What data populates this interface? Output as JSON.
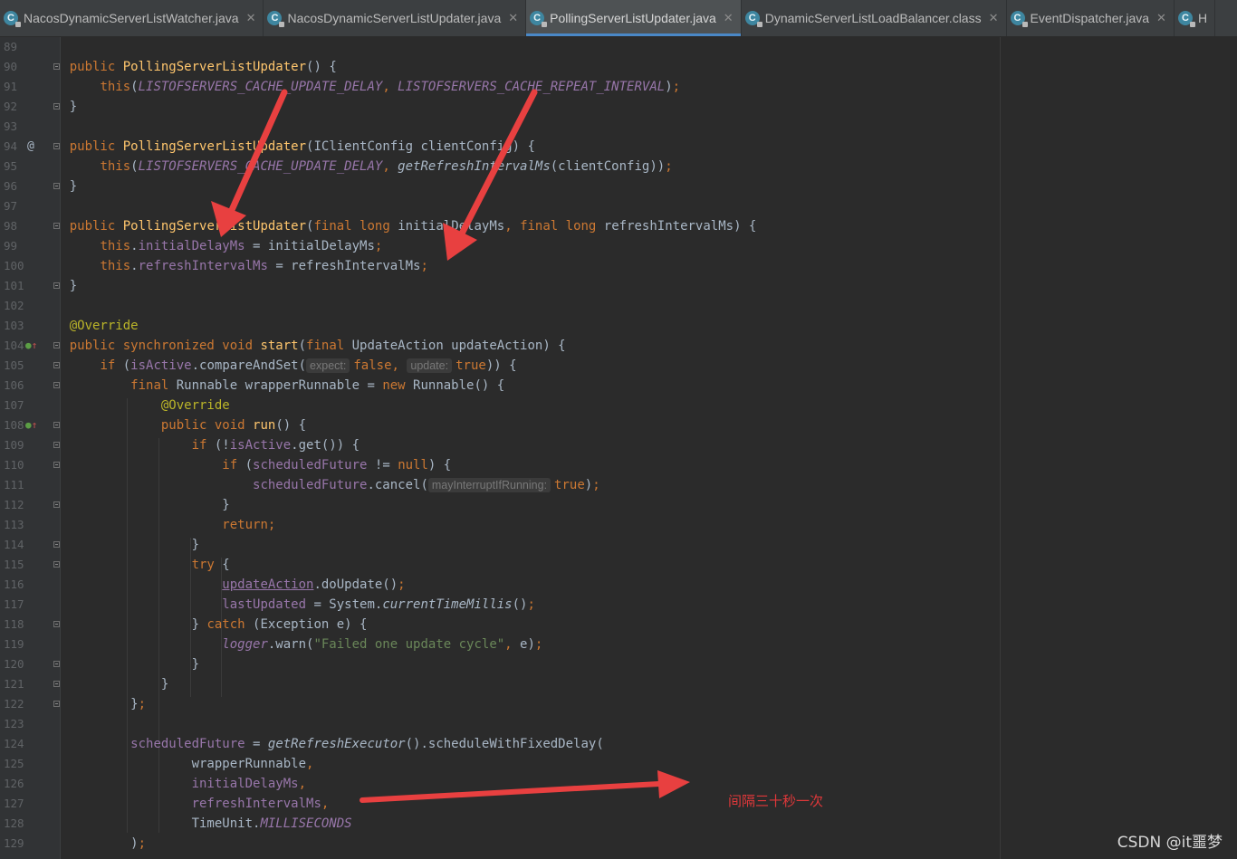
{
  "tabs": [
    {
      "label": "NacosDynamicServerListWatcher.java",
      "icon": "java-class-icon",
      "active": false
    },
    {
      "label": "NacosDynamicServerListUpdater.java",
      "icon": "java-class-icon",
      "active": false
    },
    {
      "label": "PollingServerListUpdater.java",
      "icon": "java-class-icon",
      "active": true
    },
    {
      "label": "DynamicServerListLoadBalancer.class",
      "icon": "java-class-icon",
      "active": false
    },
    {
      "label": "EventDispatcher.java",
      "icon": "java-class-icon",
      "active": false
    },
    {
      "label": "H",
      "icon": "java-class-icon",
      "active": false
    }
  ],
  "tab_close_glyph": "✕",
  "tab_icon_letter": "C",
  "gutter": {
    "line_numbers": [
      "89",
      "90",
      "91",
      "92",
      "93",
      "94",
      "95",
      "96",
      "97",
      "98",
      "99",
      "100",
      "101",
      "102",
      "103",
      "104",
      "105",
      "106",
      "107",
      "108",
      "109",
      "110",
      "111",
      "112",
      "113",
      "114",
      "115",
      "116",
      "117",
      "118",
      "119",
      "120",
      "121",
      "122",
      "123",
      "124",
      "125",
      "126",
      "127",
      "128",
      "129"
    ],
    "markers": {
      "94": "@",
      "104": "implements-icon",
      "108": "implements-icon"
    }
  },
  "code_lines": [
    [],
    [
      {
        "t": "    "
      },
      {
        "t": "public ",
        "c": "kw"
      },
      {
        "t": "PollingServerListUpdater",
        "c": "fn"
      },
      {
        "t": "() {"
      }
    ],
    [
      {
        "t": "        "
      },
      {
        "t": "this",
        "c": "kw"
      },
      {
        "t": "("
      },
      {
        "t": "LISTOFSERVERS_CACHE_UPDATE_DELAY",
        "c": "sfld"
      },
      {
        "t": ", ",
        "c": "kw"
      },
      {
        "t": "LISTOFSERVERS_CACHE_REPEAT_INTERVAL",
        "c": "sfld"
      },
      {
        "t": ")"
      },
      {
        "t": ";",
        "c": "kw"
      }
    ],
    [
      {
        "t": "    }"
      }
    ],
    [],
    [
      {
        "t": "    "
      },
      {
        "t": "public ",
        "c": "kw"
      },
      {
        "t": "PollingServerListUpdater",
        "c": "fn"
      },
      {
        "t": "(IClientConfig clientConfig) {"
      }
    ],
    [
      {
        "t": "        "
      },
      {
        "t": "this",
        "c": "kw"
      },
      {
        "t": "("
      },
      {
        "t": "LISTOFSERVERS_CACHE_UPDATE_DELAY",
        "c": "sfld"
      },
      {
        "t": ", ",
        "c": "kw"
      },
      {
        "t": "getRefreshIntervalMs",
        "c": "sm"
      },
      {
        "t": "(clientConfig))"
      },
      {
        "t": ";",
        "c": "kw"
      }
    ],
    [
      {
        "t": "    }"
      }
    ],
    [],
    [
      {
        "t": "    "
      },
      {
        "t": "public ",
        "c": "kw"
      },
      {
        "t": "PollingServerListUpdater",
        "c": "fn"
      },
      {
        "t": "("
      },
      {
        "t": "final long ",
        "c": "kw"
      },
      {
        "t": "initialDelayMs"
      },
      {
        "t": ", ",
        "c": "kw"
      },
      {
        "t": "final long ",
        "c": "kw"
      },
      {
        "t": "refreshIntervalMs) {"
      }
    ],
    [
      {
        "t": "        "
      },
      {
        "t": "this",
        "c": "kw"
      },
      {
        "t": "."
      },
      {
        "t": "initialDelayMs",
        "c": "fld"
      },
      {
        "t": " = initialDelayMs"
      },
      {
        "t": ";",
        "c": "kw"
      }
    ],
    [
      {
        "t": "        "
      },
      {
        "t": "this",
        "c": "kw"
      },
      {
        "t": "."
      },
      {
        "t": "refreshIntervalMs",
        "c": "fld"
      },
      {
        "t": " = refreshIntervalMs"
      },
      {
        "t": ";",
        "c": "kw"
      }
    ],
    [
      {
        "t": "    }"
      }
    ],
    [],
    [
      {
        "t": "    "
      },
      {
        "t": "@Override",
        "c": "ann"
      }
    ],
    [
      {
        "t": "    "
      },
      {
        "t": "public synchronized void ",
        "c": "kw"
      },
      {
        "t": "start",
        "c": "fn"
      },
      {
        "t": "("
      },
      {
        "t": "final ",
        "c": "kw"
      },
      {
        "t": "UpdateAction updateAction) {"
      }
    ],
    [
      {
        "t": "        "
      },
      {
        "t": "if ",
        "c": "kw"
      },
      {
        "t": "("
      },
      {
        "t": "isActive",
        "c": "fld"
      },
      {
        "t": ".compareAndSet("
      },
      {
        "t": "expect:",
        "c": "hint"
      },
      {
        "t": "false",
        "c": "kw"
      },
      {
        "t": ", ",
        "c": "kw"
      },
      {
        "t": "update:",
        "c": "hint"
      },
      {
        "t": "true",
        "c": "kw"
      },
      {
        "t": ")) {"
      }
    ],
    [
      {
        "t": "            "
      },
      {
        "t": "final ",
        "c": "kw"
      },
      {
        "t": "Runnable wrapperRunnable = "
      },
      {
        "t": "new ",
        "c": "kw"
      },
      {
        "t": "Runnable() {"
      }
    ],
    [
      {
        "t": "                "
      },
      {
        "t": "@Override",
        "c": "ann"
      }
    ],
    [
      {
        "t": "                "
      },
      {
        "t": "public void ",
        "c": "kw"
      },
      {
        "t": "run",
        "c": "fn"
      },
      {
        "t": "() {"
      }
    ],
    [
      {
        "t": "                    "
      },
      {
        "t": "if ",
        "c": "kw"
      },
      {
        "t": "(!"
      },
      {
        "t": "isActive",
        "c": "fld"
      },
      {
        "t": ".get()) {"
      }
    ],
    [
      {
        "t": "                        "
      },
      {
        "t": "if ",
        "c": "kw"
      },
      {
        "t": "("
      },
      {
        "t": "scheduledFuture",
        "c": "fld"
      },
      {
        "t": " != "
      },
      {
        "t": "null",
        "c": "kw"
      },
      {
        "t": ") {"
      }
    ],
    [
      {
        "t": "                            "
      },
      {
        "t": "scheduledFuture",
        "c": "fld"
      },
      {
        "t": ".cancel("
      },
      {
        "t": "mayInterruptIfRunning:",
        "c": "hint"
      },
      {
        "t": "true",
        "c": "kw"
      },
      {
        "t": ")"
      },
      {
        "t": ";",
        "c": "kw"
      }
    ],
    [
      {
        "t": "                        }"
      }
    ],
    [
      {
        "t": "                        "
      },
      {
        "t": "return;",
        "c": "kw"
      }
    ],
    [
      {
        "t": "                    }"
      }
    ],
    [
      {
        "t": "                    "
      },
      {
        "t": "try ",
        "c": "kw"
      },
      {
        "t": "{"
      }
    ],
    [
      {
        "t": "                        "
      },
      {
        "t": "updateAction",
        "c": "fld ul"
      },
      {
        "t": ".doUpdate()"
      },
      {
        "t": ";",
        "c": "kw"
      }
    ],
    [
      {
        "t": "                        "
      },
      {
        "t": "lastUpdated",
        "c": "fld"
      },
      {
        "t": " = System."
      },
      {
        "t": "currentTimeMillis",
        "c": "sm"
      },
      {
        "t": "()"
      },
      {
        "t": ";",
        "c": "kw"
      }
    ],
    [
      {
        "t": "                    } "
      },
      {
        "t": "catch ",
        "c": "kw"
      },
      {
        "t": "(Exception e) {"
      }
    ],
    [
      {
        "t": "                        "
      },
      {
        "t": "logger",
        "c": "sfld"
      },
      {
        "t": ".warn("
      },
      {
        "t": "\"Failed one update cycle\"",
        "c": "str"
      },
      {
        "t": ", ",
        "c": "kw"
      },
      {
        "t": "e)"
      },
      {
        "t": ";",
        "c": "kw"
      }
    ],
    [
      {
        "t": "                    }"
      }
    ],
    [
      {
        "t": "                }"
      }
    ],
    [
      {
        "t": "            }"
      },
      {
        "t": ";",
        "c": "kw"
      }
    ],
    [],
    [
      {
        "t": "            "
      },
      {
        "t": "scheduledFuture",
        "c": "fld"
      },
      {
        "t": " = "
      },
      {
        "t": "getRefreshExecutor",
        "c": "sm"
      },
      {
        "t": "().scheduleWithFixedDelay("
      }
    ],
    [
      {
        "t": "                    wrapperRunnable"
      },
      {
        "t": ",",
        "c": "kw"
      }
    ],
    [
      {
        "t": "                    "
      },
      {
        "t": "initialDelayMs",
        "c": "fld"
      },
      {
        "t": ",",
        "c": "kw"
      }
    ],
    [
      {
        "t": "                    "
      },
      {
        "t": "refreshIntervalMs",
        "c": "fld"
      },
      {
        "t": ",",
        "c": "kw"
      }
    ],
    [
      {
        "t": "                    TimeUnit."
      },
      {
        "t": "MILLISECONDS",
        "c": "sfld"
      }
    ],
    [
      {
        "t": "            )"
      },
      {
        "t": ";",
        "c": "kw"
      }
    ]
  ],
  "annotation_note": "间隔三十秒一次",
  "watermark": "CSDN @it噩梦",
  "colors": {
    "background": "#2b2b2b",
    "keyword": "#cc7832",
    "method": "#ffc66d",
    "field": "#9876aa",
    "string": "#6a8759",
    "annotation": "#bbb529",
    "arrow": "#e84040"
  }
}
